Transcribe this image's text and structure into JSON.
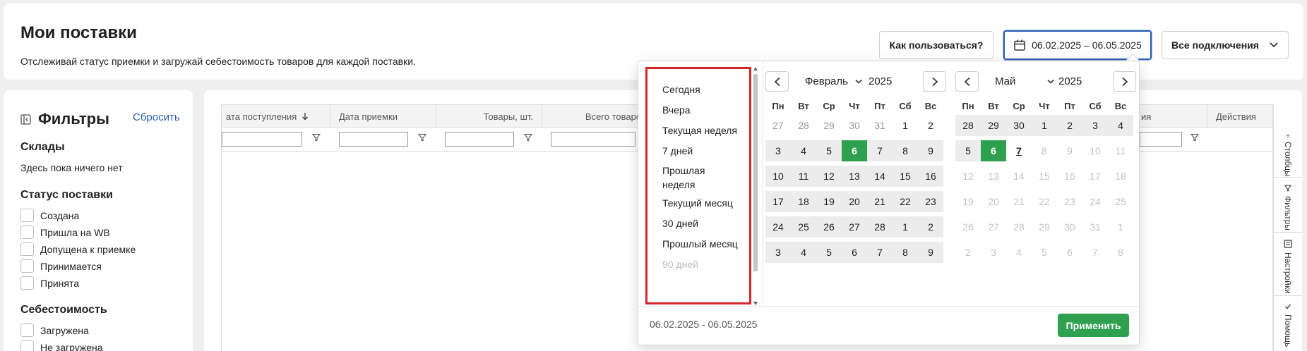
{
  "header": {
    "title": "Мои поставки",
    "subtitle": "Отслеживай статус приемки и загружай себестоимость товаров для каждой поставки.",
    "help_button": "Как пользоваться?",
    "date_range": "06.02.2025 – 06.05.2025",
    "connections_button": "Все подключения"
  },
  "sidebar": {
    "title": "Фильтры",
    "reset": "Сбросить",
    "warehouses_title": "Склады",
    "warehouses_empty": "Здесь пока ничего нет",
    "status_title": "Статус поставки",
    "status_options": [
      "Создана",
      "Пришла на WB",
      "Допущена к приемке",
      "Принимается",
      "Принята"
    ],
    "cost_title": "Себестоимость",
    "cost_options": [
      "Загружена",
      "Не загружена"
    ]
  },
  "table": {
    "columns": [
      "ата поступления",
      "Дата приемки",
      "Товары, шт.",
      "Всего товаров",
      "ия",
      "Действия"
    ]
  },
  "right_tabs": [
    "Столбцы",
    "Фильтры",
    "Настройки",
    "Помощь"
  ],
  "datepicker": {
    "presets": [
      "Сегодня",
      "Вчера",
      "Текущая неделя",
      "7 дней",
      "Прошлая неделя",
      "Текущий месяц",
      "30 дней",
      "Прошлый месяц",
      "90 дней"
    ],
    "weekdays": [
      "Пн",
      "Вт",
      "Ср",
      "Чт",
      "Пт",
      "Сб",
      "Вс"
    ],
    "left": {
      "month": "Февраль",
      "year": "2025",
      "weeks": [
        [
          "27",
          "28",
          "29",
          "30",
          "31",
          "1",
          "2"
        ],
        [
          "3",
          "4",
          "5",
          "6",
          "7",
          "8",
          "9"
        ],
        [
          "10",
          "11",
          "12",
          "13",
          "14",
          "15",
          "16"
        ],
        [
          "17",
          "18",
          "19",
          "20",
          "21",
          "22",
          "23"
        ],
        [
          "24",
          "25",
          "26",
          "27",
          "28",
          "1",
          "2"
        ],
        [
          "3",
          "4",
          "5",
          "6",
          "7",
          "8",
          "9"
        ]
      ]
    },
    "right": {
      "month": "Май",
      "year": "2025",
      "weeks": [
        [
          "28",
          "29",
          "30",
          "1",
          "2",
          "3",
          "4"
        ],
        [
          "5",
          "6",
          "7",
          "8",
          "9",
          "10",
          "11"
        ],
        [
          "12",
          "13",
          "14",
          "15",
          "16",
          "17",
          "18"
        ],
        [
          "19",
          "20",
          "21",
          "22",
          "23",
          "24",
          "25"
        ],
        [
          "26",
          "27",
          "28",
          "29",
          "30",
          "31",
          "1"
        ],
        [
          "2",
          "3",
          "4",
          "5",
          "6",
          "7",
          "8"
        ]
      ]
    },
    "footer_range": "06.02.2025 - 06.05.2025",
    "apply": "Применить",
    "colors": {
      "selected": "#2fa050",
      "highlight_border": "#d9232b"
    }
  }
}
